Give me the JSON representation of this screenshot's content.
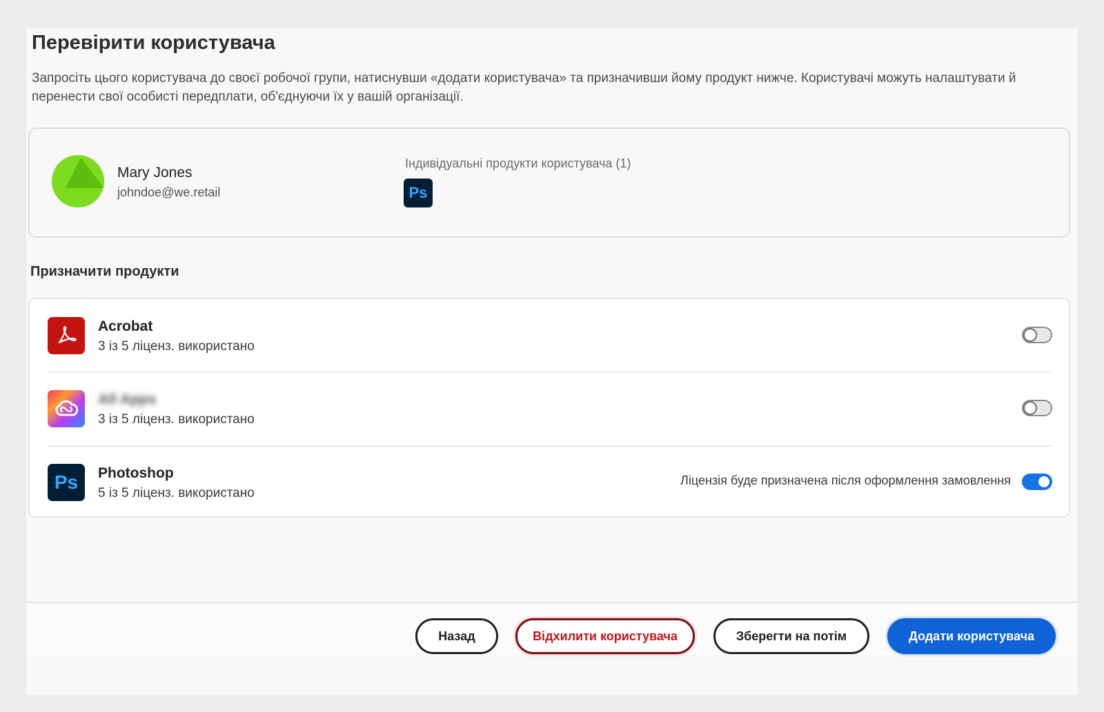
{
  "dialog": {
    "title": "Перевірити користувача",
    "description": "Запросіть цього користувача до своєї робочої групи, натиснувши «додати користувача» та призначивши йому продукт нижче. Користувачі можуть налаштувати й перенести свої особисті передплати, об'єднуючи їх у вашій організації."
  },
  "user": {
    "name": "Mary Jones",
    "email": "johndoe@we.retail",
    "avatar_color": "#7ddc1f",
    "individual_products_title": "Індивідуальні продукти користувача (1)",
    "individual_products": [
      {
        "icon": "photoshop-icon",
        "label": "Ps"
      }
    ]
  },
  "assign": {
    "title": "Призначити продукти",
    "products": [
      {
        "name": "Acrobat",
        "usage": "3 із 5 ліценз. використано",
        "icon": "acrobat-icon",
        "enabled": false,
        "note": ""
      },
      {
        "name": "All Apps",
        "usage": "3 із 5 ліценз. використано",
        "icon": "creative-cloud-icon",
        "enabled": false,
        "note": "",
        "name_blurred": true
      },
      {
        "name": "Photoshop",
        "usage": "5 із 5 ліценз. використано",
        "icon": "photoshop-icon",
        "icon_label": "Ps",
        "enabled": true,
        "note": "Ліцензія буде призначена після оформлення замовлення"
      }
    ]
  },
  "footer": {
    "back_label": "Назад",
    "reject_label": "Відхилити користувача",
    "save_label": "Зберегти на потім",
    "add_label": "Додати користувача"
  },
  "colors": {
    "primary": "#0f63d6",
    "reject": "#c4151c",
    "toggle_on": "#1473e6"
  }
}
